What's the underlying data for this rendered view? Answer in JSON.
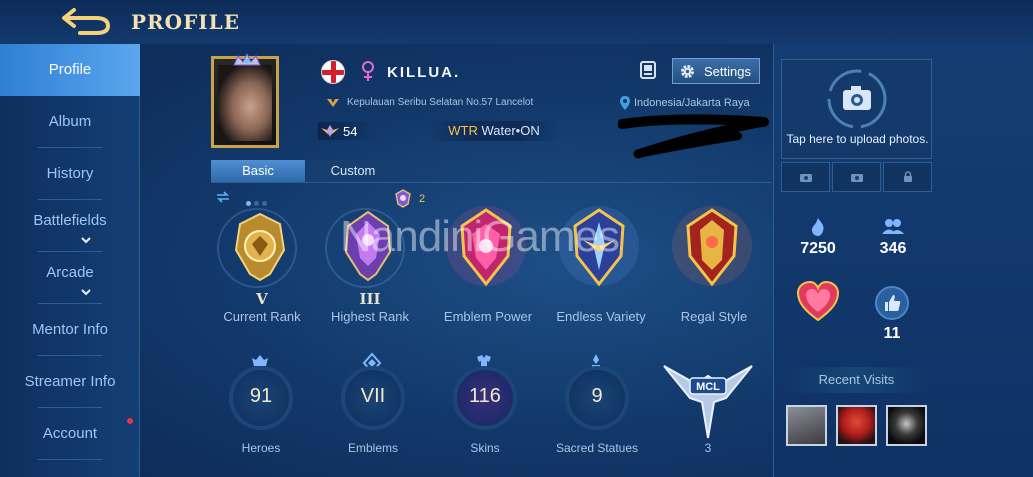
{
  "header": {
    "title": "PROFILE",
    "back_icon": "back-arrow-icon"
  },
  "sidebar": {
    "items": [
      {
        "label": "Profile",
        "active": true
      },
      {
        "label": "Album"
      },
      {
        "label": "History"
      },
      {
        "label": "Battlefields",
        "expandable": true
      },
      {
        "label": "Arcade",
        "expandable": true
      },
      {
        "label": "Mentor Info"
      },
      {
        "label": "Streamer Info"
      },
      {
        "label": "Account",
        "notification": true
      }
    ]
  },
  "profile": {
    "name": "KILLUA.",
    "gender_icon": "female-icon",
    "flag_icon": "england-flag-icon",
    "address": "Kepulauan Seribu Selatan No.57 Lancelot",
    "region": "Indonesia/Jakarta Raya",
    "level_badge": "54",
    "squad_tag": "WTR",
    "squad_name": "Water•ON",
    "settings_label": "Settings"
  },
  "tabs": [
    {
      "label": "Basic",
      "active": true
    },
    {
      "label": "Custom"
    }
  ],
  "mini_rank_count": "2",
  "ranks": [
    {
      "roman": "V",
      "caption": "Current Rank"
    },
    {
      "roman": "III",
      "caption": "Highest Rank"
    },
    {
      "roman": "",
      "caption": "Emblem Power"
    },
    {
      "roman": "",
      "caption": "Endless Variety"
    },
    {
      "roman": "",
      "caption": "Regal Style"
    }
  ],
  "watermark": "NandiniGames",
  "stats": [
    {
      "value": "91",
      "caption": "Heroes"
    },
    {
      "value": "VII",
      "caption": "Emblems"
    },
    {
      "value": "116",
      "caption": "Skins"
    },
    {
      "value": "9",
      "caption": "Sacred Statues"
    }
  ],
  "mcl": {
    "label": "MCL",
    "count": "3"
  },
  "right_panel": {
    "upload_text": "Tap here to upload photos.",
    "popularity": "7250",
    "followers": "346",
    "likes": "11",
    "recent_title": "Recent Visits"
  },
  "colors": {
    "accent_gold": "#f2c44c",
    "active_blue": "#2f7fd4",
    "background": "#12386a"
  }
}
